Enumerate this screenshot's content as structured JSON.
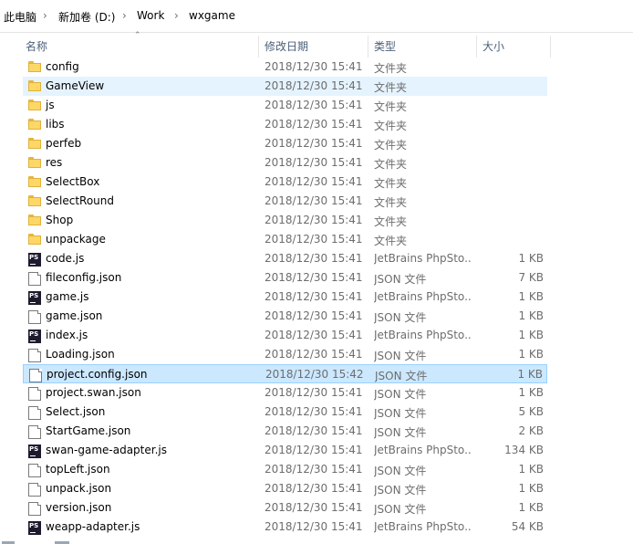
{
  "breadcrumb": [
    "此电脑",
    "新加卷 (D:)",
    "Work",
    "wxgame"
  ],
  "columns": {
    "name": "名称",
    "modified": "修改日期",
    "type": "类型",
    "size": "大小"
  },
  "colors": {
    "hover_row": "#e5f3ff",
    "selected_row": "#cce8ff",
    "folder": "#ffd766"
  },
  "files": [
    {
      "name": "config",
      "date": "2018/12/30 15:41",
      "type": "文件夹",
      "size": "",
      "icon": "folder-icon"
    },
    {
      "name": "GameView",
      "date": "2018/12/30 15:41",
      "type": "文件夹",
      "size": "",
      "icon": "folder-icon",
      "state": "hover"
    },
    {
      "name": "js",
      "date": "2018/12/30 15:41",
      "type": "文件夹",
      "size": "",
      "icon": "folder-icon"
    },
    {
      "name": "libs",
      "date": "2018/12/30 15:41",
      "type": "文件夹",
      "size": "",
      "icon": "folder-icon"
    },
    {
      "name": "perfeb",
      "date": "2018/12/30 15:41",
      "type": "文件夹",
      "size": "",
      "icon": "folder-icon"
    },
    {
      "name": "res",
      "date": "2018/12/30 15:41",
      "type": "文件夹",
      "size": "",
      "icon": "folder-icon"
    },
    {
      "name": "SelectBox",
      "date": "2018/12/30 15:41",
      "type": "文件夹",
      "size": "",
      "icon": "folder-icon"
    },
    {
      "name": "SelectRound",
      "date": "2018/12/30 15:41",
      "type": "文件夹",
      "size": "",
      "icon": "folder-icon"
    },
    {
      "name": "Shop",
      "date": "2018/12/30 15:41",
      "type": "文件夹",
      "size": "",
      "icon": "folder-icon"
    },
    {
      "name": "unpackage",
      "date": "2018/12/30 15:41",
      "type": "文件夹",
      "size": "",
      "icon": "folder-icon"
    },
    {
      "name": "code.js",
      "date": "2018/12/30 15:41",
      "type": "JetBrains PhpSto...",
      "size": "1 KB",
      "icon": "phpstorm-icon"
    },
    {
      "name": "fileconfig.json",
      "date": "2018/12/30 15:41",
      "type": "JSON 文件",
      "size": "7 KB",
      "icon": "json-file-icon"
    },
    {
      "name": "game.js",
      "date": "2018/12/30 15:41",
      "type": "JetBrains PhpSto...",
      "size": "1 KB",
      "icon": "phpstorm-icon"
    },
    {
      "name": "game.json",
      "date": "2018/12/30 15:41",
      "type": "JSON 文件",
      "size": "1 KB",
      "icon": "json-file-icon"
    },
    {
      "name": "index.js",
      "date": "2018/12/30 15:41",
      "type": "JetBrains PhpSto...",
      "size": "1 KB",
      "icon": "phpstorm-icon"
    },
    {
      "name": "Loading.json",
      "date": "2018/12/30 15:41",
      "type": "JSON 文件",
      "size": "1 KB",
      "icon": "json-file-icon"
    },
    {
      "name": "project.config.json",
      "date": "2018/12/30 15:42",
      "type": "JSON 文件",
      "size": "1 KB",
      "icon": "json-file-icon",
      "state": "selected"
    },
    {
      "name": "project.swan.json",
      "date": "2018/12/30 15:41",
      "type": "JSON 文件",
      "size": "1 KB",
      "icon": "json-file-icon"
    },
    {
      "name": "Select.json",
      "date": "2018/12/30 15:41",
      "type": "JSON 文件",
      "size": "5 KB",
      "icon": "json-file-icon"
    },
    {
      "name": "StartGame.json",
      "date": "2018/12/30 15:41",
      "type": "JSON 文件",
      "size": "2 KB",
      "icon": "json-file-icon"
    },
    {
      "name": "swan-game-adapter.js",
      "date": "2018/12/30 15:41",
      "type": "JetBrains PhpSto...",
      "size": "134 KB",
      "icon": "phpstorm-icon"
    },
    {
      "name": "topLeft.json",
      "date": "2018/12/30 15:41",
      "type": "JSON 文件",
      "size": "1 KB",
      "icon": "json-file-icon"
    },
    {
      "name": "unpack.json",
      "date": "2018/12/30 15:41",
      "type": "JSON 文件",
      "size": "1 KB",
      "icon": "json-file-icon"
    },
    {
      "name": "version.json",
      "date": "2018/12/30 15:41",
      "type": "JSON 文件",
      "size": "1 KB",
      "icon": "json-file-icon"
    },
    {
      "name": "weapp-adapter.js",
      "date": "2018/12/30 15:41",
      "type": "JetBrains PhpSto...",
      "size": "54 KB",
      "icon": "phpstorm-icon"
    }
  ]
}
